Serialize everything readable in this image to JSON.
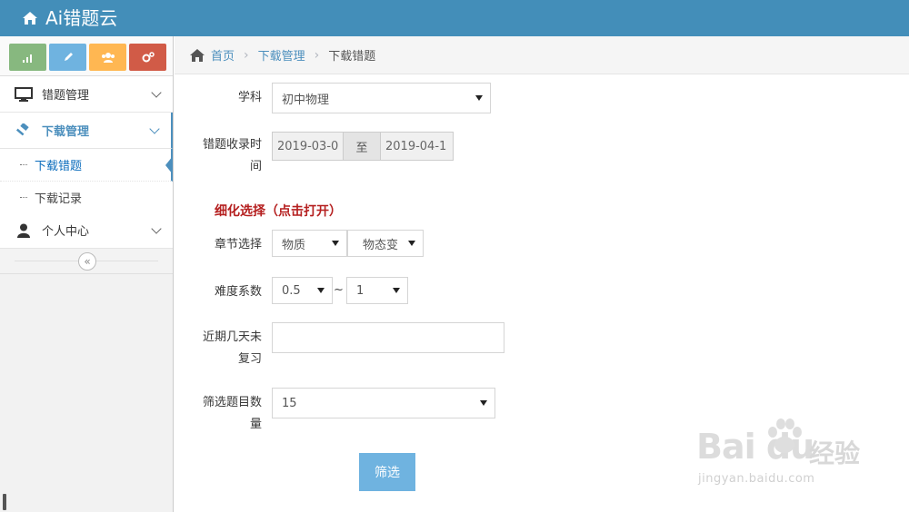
{
  "app": {
    "title": "Ai错题云"
  },
  "sidebar": {
    "items": [
      {
        "label": "错题管理",
        "icon": "desktop-icon"
      },
      {
        "label": "下载管理",
        "icon": "gavel-icon",
        "open": true,
        "children": [
          {
            "label": "下载错题",
            "active": true
          },
          {
            "label": "下载记录"
          }
        ]
      },
      {
        "label": "个人中心",
        "icon": "user-icon"
      }
    ],
    "shortcuts": [
      "signal-icon",
      "pencil-icon",
      "users-icon",
      "cogs-icon"
    ],
    "collapse_glyph": "«"
  },
  "breadcrumb": {
    "home": "首页",
    "section": "下载管理",
    "current": "下载错题",
    "sep": "›"
  },
  "form": {
    "subject_label": "学科",
    "subject_value": "初中物理",
    "date_label_line1": "错题收录时",
    "date_label_line2": "间",
    "date_from": "2019-03-0",
    "date_to_word": "至",
    "date_to": "2019-04-1",
    "refine_label": "细化选择（点击打开）",
    "chapter_label": "章节选择",
    "chapter_value": "物质",
    "section_value": "物态变",
    "difficulty_label": "难度系数",
    "difficulty_min": "0.5",
    "difficulty_sep": "~",
    "difficulty_max": "1",
    "review_label_line1": "近期几天未",
    "review_label_line2": "复习",
    "review_value": "",
    "count_label_line1": "筛选题目数",
    "count_label_line2": "量",
    "count_value": "15",
    "submit_label": "筛选"
  },
  "watermark": {
    "brand": "Bai du",
    "cn": "经验",
    "url": "jingyan.baidu.com"
  }
}
